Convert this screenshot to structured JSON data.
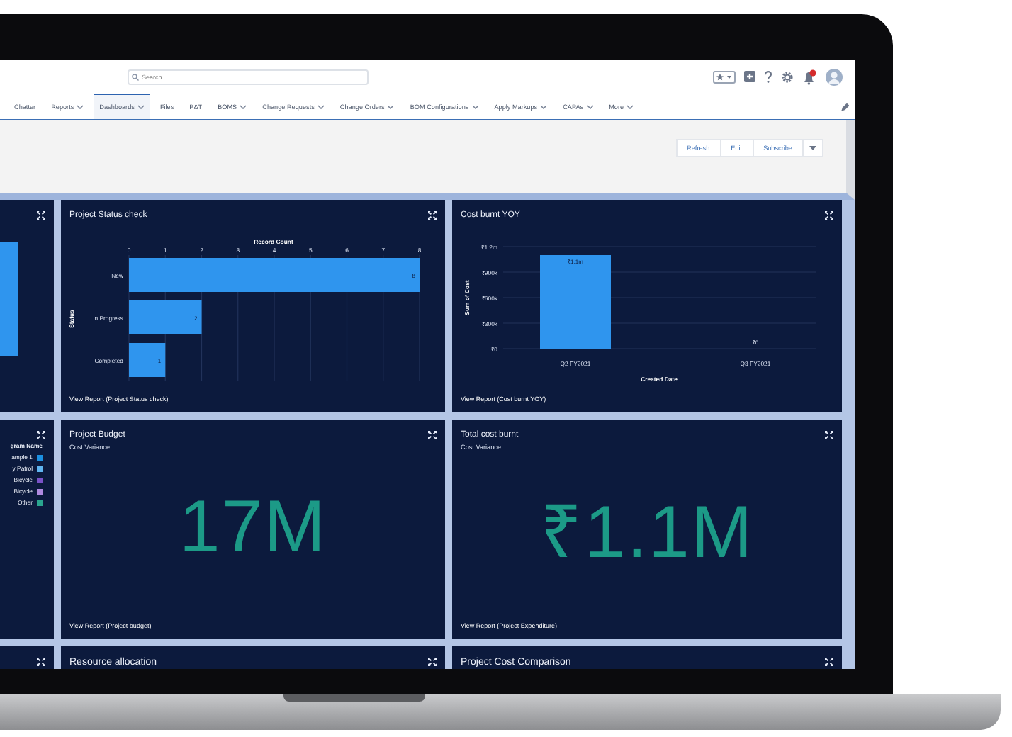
{
  "header": {
    "search": {
      "placeholder": "Search..."
    }
  },
  "nav": [
    {
      "label": "Chatter",
      "menu": false,
      "selected": false
    },
    {
      "label": "Reports",
      "menu": true,
      "selected": false
    },
    {
      "label": "Dashboards",
      "menu": true,
      "selected": true
    },
    {
      "label": "Files",
      "menu": false,
      "selected": false
    },
    {
      "label": "P&T",
      "menu": false,
      "selected": false
    },
    {
      "label": "BOMS",
      "menu": true,
      "selected": false
    },
    {
      "label": "Change Requests",
      "menu": true,
      "selected": false
    },
    {
      "label": "Change Orders",
      "menu": true,
      "selected": false
    },
    {
      "label": "BOM Configurations",
      "menu": true,
      "selected": false
    },
    {
      "label": "Apply Markups",
      "menu": true,
      "selected": false
    },
    {
      "label": "CAPAs",
      "menu": true,
      "selected": false
    },
    {
      "label": "More",
      "menu": true,
      "selected": false
    }
  ],
  "dashboard_buttons": [
    "Refresh",
    "Edit",
    "Subscribe"
  ],
  "tiles": [
    {
      "kind": "partial_chart"
    },
    {
      "kind": "chart",
      "title": "Project Status check",
      "footer": "View Report (Project Status check)",
      "chart_data": {
        "type": "bar",
        "orientation": "horizontal",
        "xlabel": "Record Count",
        "ylabel": "Status",
        "categories": [
          "New",
          "In Progress",
          "Completed"
        ],
        "values": [
          8,
          2,
          1
        ],
        "xlim": [
          0,
          8
        ],
        "grid": true,
        "xticks": [
          0,
          1,
          2,
          3,
          4,
          5,
          6,
          7,
          8
        ],
        "data_labels": true
      }
    },
    {
      "kind": "chart",
      "title": "Cost burnt YOY",
      "footer": "View Report (Cost burnt YOY)",
      "chart_data": {
        "type": "bar",
        "orientation": "vertical",
        "xlabel": "Created Date",
        "ylabel": "Sum of Cost",
        "categories": [
          "Q2 FY2021",
          "Q3 FY2021"
        ],
        "values": [
          1100000,
          0
        ],
        "ylim": [
          0,
          1200000
        ],
        "grid": true,
        "yticks": [
          {
            "value": 0,
            "label": "₹0"
          },
          {
            "value": 300000,
            "label": "₹300k"
          },
          {
            "value": 600000,
            "label": "₹600k"
          },
          {
            "value": 900000,
            "label": "₹900k"
          },
          {
            "value": 1200000,
            "label": "₹1.2m"
          }
        ],
        "value_labels": [
          "₹1.1m",
          "₹0"
        ]
      }
    },
    {
      "kind": "legend",
      "legend_title": "gram Name",
      "items": [
        {
          "label": "ample 1",
          "color": "#1b8fe0"
        },
        {
          "label": "y Patrol",
          "color": "#5fb4f0"
        },
        {
          "label": "Bicycle",
          "color": "#7a52c8"
        },
        {
          "label": "Bicycle",
          "color": "#b08ae0"
        },
        {
          "label": "Other",
          "color": "#2aa58f"
        }
      ]
    },
    {
      "kind": "metric",
      "title": "Project Budget",
      "subtitle": "Cost Variance",
      "value": "17M",
      "footer": "View Report (Project budget)"
    },
    {
      "kind": "metric",
      "title": "Total cost burnt",
      "subtitle": "Cost Variance",
      "value": "₹1.1M",
      "footer": "View Report (Project Expenditure)"
    },
    {
      "kind": "empty"
    },
    {
      "kind": "header_only",
      "title": "Resource allocation"
    },
    {
      "kind": "header_only",
      "title": "Project Cost Comparison"
    }
  ]
}
